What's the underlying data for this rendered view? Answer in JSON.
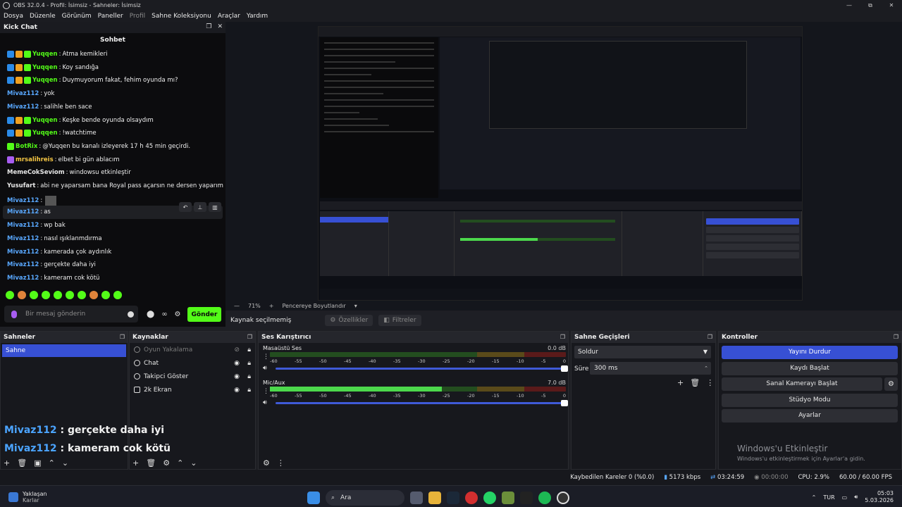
{
  "window": {
    "title": "OBS 32.0.4 - Profil: İsimsiz - Sahneler: İsimsiz",
    "min": "—",
    "max": "⧉",
    "close": "✕"
  },
  "menu": {
    "file": "Dosya",
    "edit": "Düzenle",
    "view": "Görünüm",
    "docks": "Paneller",
    "profile": "Profil",
    "scene_collection": "Sahne Koleksiyonu",
    "tools": "Araçlar",
    "help": "Yardım"
  },
  "chat": {
    "dock_title": "Kick Chat",
    "header": "Sohbet",
    "messages": [
      {
        "user": "Yuqqen",
        "sep": ":",
        "text": "Atma kemikleri"
      },
      {
        "user": "Yuqqen",
        "sep": ":",
        "text": "Koy sandığa"
      },
      {
        "user": "Yuqqen",
        "sep": ":",
        "text": "Duymuyorum fakat, fehim oyunda mı?"
      },
      {
        "user": "Mivaz112",
        "sep": ":",
        "text": "yok"
      },
      {
        "user": "Mivaz112",
        "sep": ":",
        "text": "salihle ben sace"
      },
      {
        "user": "Yuqqen",
        "sep": ":",
        "text": "Keşke bende oyunda olsaydım"
      },
      {
        "user": "Yuqqen",
        "sep": ":",
        "text": "!watchtime"
      },
      {
        "user": "BotRix",
        "sep": ":",
        "text": "@Yuqqen bu kanalı izleyerek 17 h 45 min geçirdi."
      },
      {
        "user": "mrsalihreis",
        "sep": ":",
        "text": "elbet bi gün ablacım"
      },
      {
        "user": "MemeCokSeviom",
        "sep": ":",
        "text": "windowsu etkinleştir"
      },
      {
        "user": "Yusufart",
        "sep": ":",
        "text": "abi ne yaparsam bana Royal pass açarsın ne dersen yaparım"
      },
      {
        "user": "Mivaz112",
        "sep": ":",
        "text": ""
      },
      {
        "user": "Mivaz112",
        "sep": ":",
        "text": "as"
      },
      {
        "user": "Mivaz112",
        "sep": ":",
        "text": "wp bak"
      },
      {
        "user": "Mivaz112",
        "sep": ":",
        "text": "nasıl ışıklanmdırma"
      },
      {
        "user": "Mivaz112",
        "sep": ":",
        "text": "kamerada çok aydınlık"
      },
      {
        "user": "Mivaz112",
        "sep": ":",
        "text": "gerçekte daha iyi"
      },
      {
        "user": "Mivaz112",
        "sep": ":",
        "text": "kameram cok kötü"
      }
    ],
    "input_placeholder": "Bir mesaj gönderin",
    "send_label": "Gönder",
    "infinity": "∞"
  },
  "preview": {
    "zoom": "71%",
    "resize_label": "Pencereye Boyutlandır",
    "no_source": "Kaynak seçilmemiş",
    "properties": "Özellikler",
    "filters": "Filtreler"
  },
  "scenes": {
    "title": "Sahneler",
    "items": [
      "Sahne"
    ]
  },
  "sources": {
    "title": "Kaynaklar",
    "items": [
      "Oyun Yakalama",
      "Chat",
      "Takipci Göster",
      "2k Ekran"
    ]
  },
  "overlay": {
    "line1_user": "Mivaz112",
    "line1_text": " : gerçekte daha iyi",
    "line2_user": "Mivaz112",
    "line2_text": " : kameram cok kötü"
  },
  "mixer": {
    "title": "Ses Karıştırıcı",
    "tracks": [
      {
        "name": "Masaüstü Ses",
        "db": "0.0 dB",
        "level": 0
      },
      {
        "name": "Mic/Aux",
        "db": "7.0 dB",
        "level": 0.58
      }
    ],
    "scale": [
      "-60",
      "-55",
      "-50",
      "-45",
      "-40",
      "-35",
      "-30",
      "-25",
      "-20",
      "-15",
      "-10",
      "-5",
      "0"
    ]
  },
  "transitions": {
    "title": "Sahne Geçişleri",
    "selected": "Soldur",
    "duration_label": "Süre",
    "duration": "300 ms"
  },
  "controls": {
    "title": "Kontroller",
    "stop_stream": "Yayını Durdur",
    "start_record": "Kaydı Başlat",
    "virtual_cam": "Sanal Kamerayı Başlat",
    "studio_mode": "Stüdyo Modu",
    "settings": "Ayarlar"
  },
  "activation": {
    "line1": "Windows'u Etkinleştir",
    "line2": "Windows'u etkinleştirmek için Ayarlar'a gidin."
  },
  "status": {
    "dropped": "Kaybedilen Kareler 0 (%0.0)",
    "bitrate": "5173 kbps",
    "stream_time": "03:24:59",
    "rec_time": "00:00:00",
    "cpu": "CPU: 2.9%",
    "fps": "60.00 / 60.00 FPS"
  },
  "taskbar": {
    "weather_title": "Yaklaşan",
    "weather_sub": "Karlar",
    "search": "Ara",
    "lang": "TUR",
    "time": "05:03",
    "date": "5.03.2026"
  },
  "colors": {
    "kick_green": "#53fc18",
    "obs_blue": "#3750d4",
    "username_blue": "#59a8ff"
  }
}
